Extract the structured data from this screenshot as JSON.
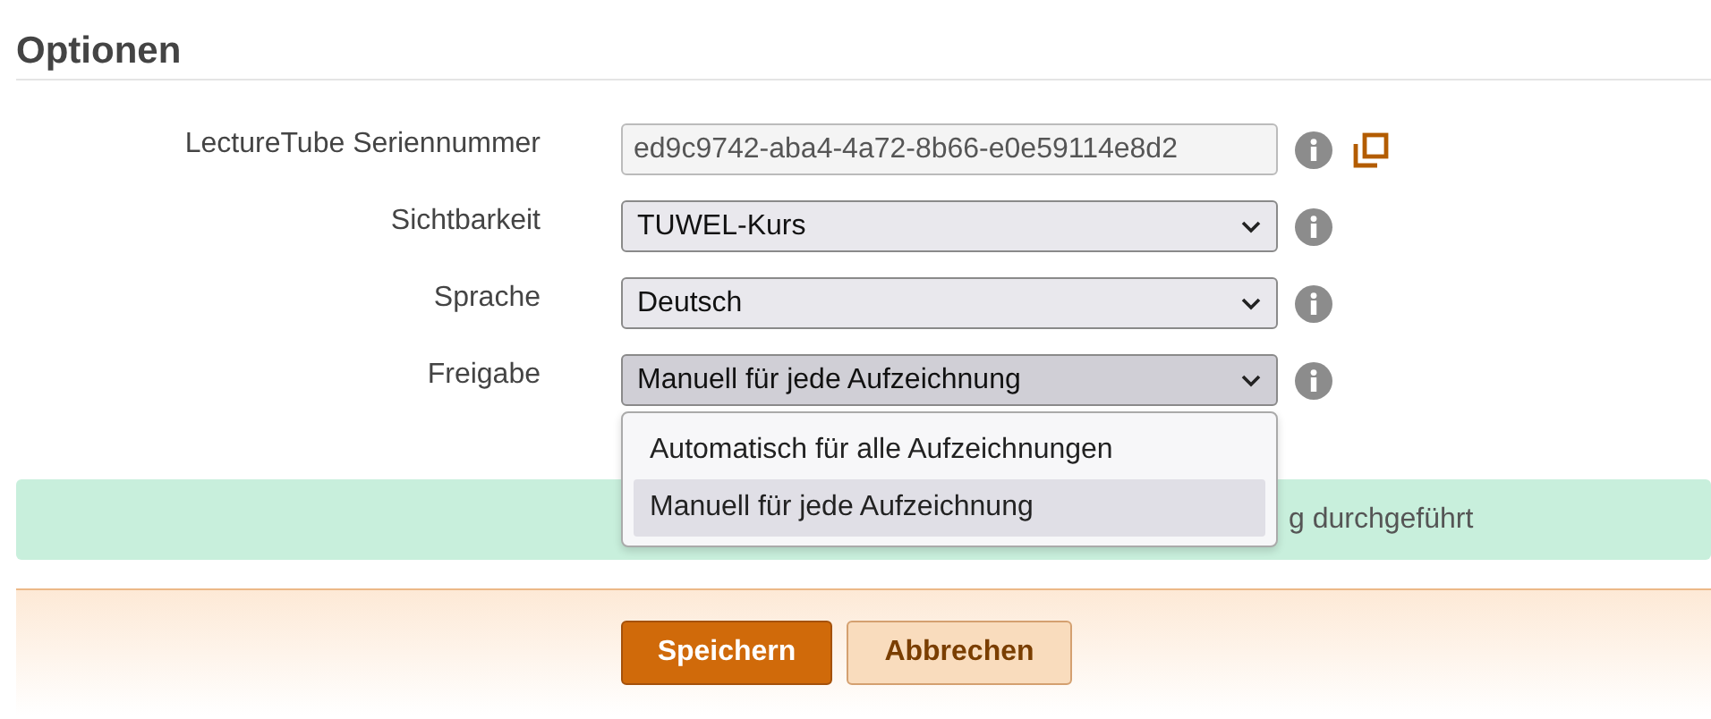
{
  "section": {
    "title": "Optionen"
  },
  "fields": [
    {
      "kind": "text",
      "label": "LectureTube Seriennummer",
      "value": "ed9c9742-aba4-4a72-8b66-e0e59114e8d2",
      "copy": true
    },
    {
      "kind": "select",
      "label": "Sichtbarkeit",
      "value": "TUWEL-Kurs"
    },
    {
      "kind": "select",
      "label": "Sprache",
      "value": "Deutsch"
    },
    {
      "kind": "select",
      "label": "Freigabe",
      "value": "Manuell für jede Aufzeichnung",
      "open": true,
      "options": [
        {
          "label": "Automatisch für alle Aufzeichnungen",
          "selected": false
        },
        {
          "label": "Manuell für jede Aufzeichnung",
          "selected": true
        }
      ]
    }
  ],
  "alert": {
    "text": "g durchgeführt"
  },
  "buttons": [
    {
      "label": "Speichern",
      "kind": "primary"
    },
    {
      "label": "Abbrechen",
      "kind": "secondary"
    }
  ]
}
